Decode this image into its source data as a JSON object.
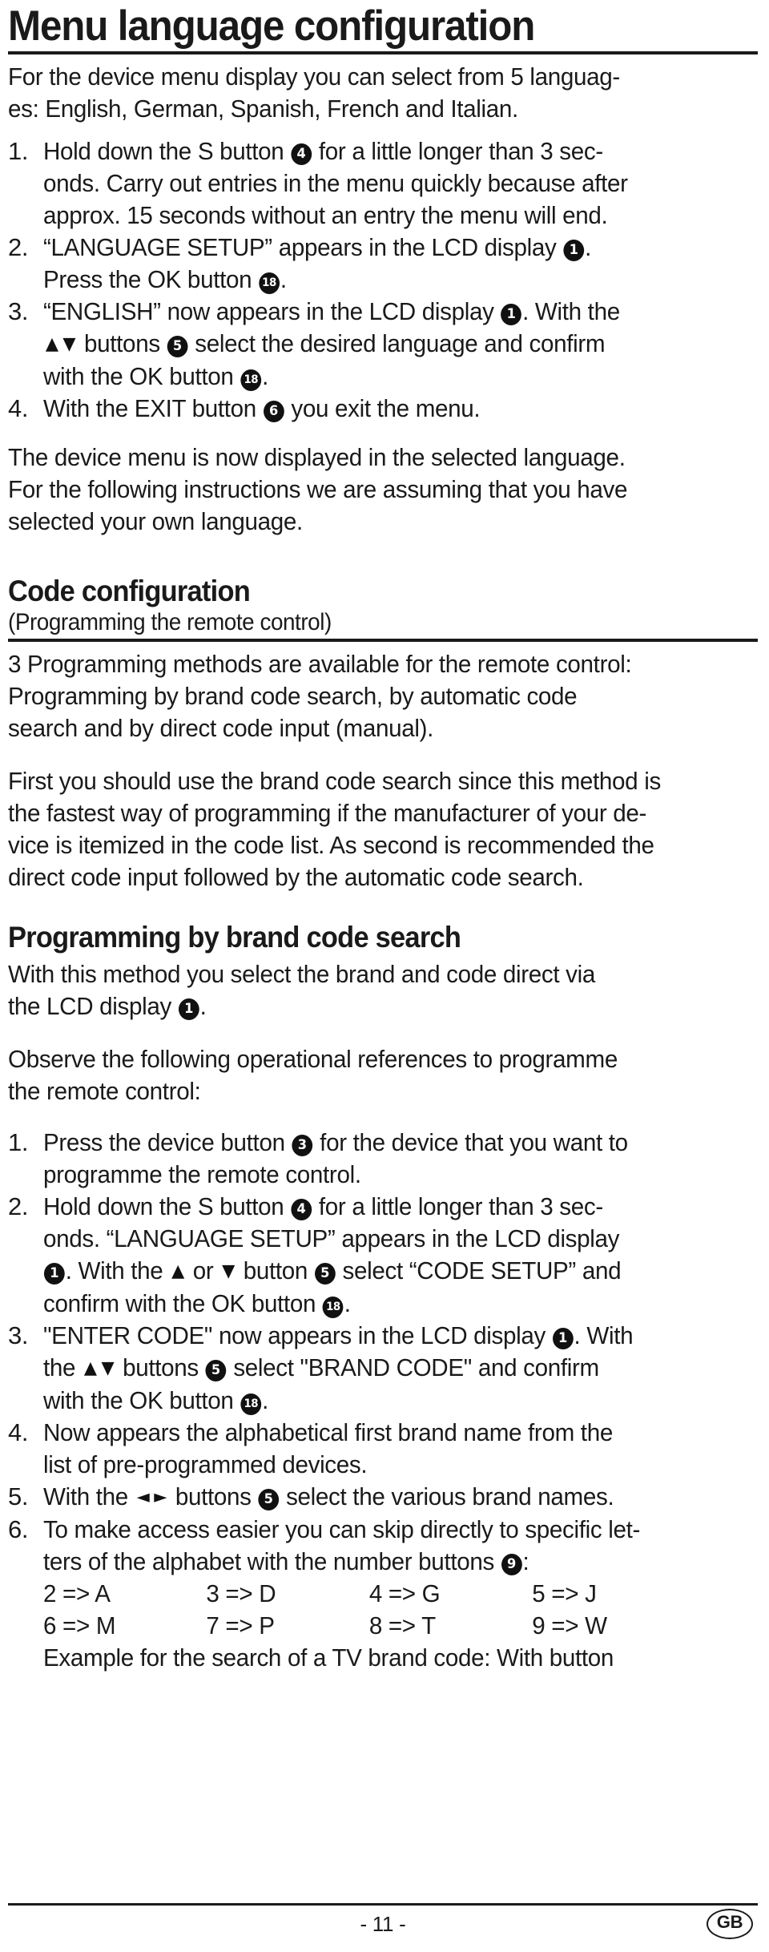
{
  "document": {
    "page_number": "- 11 -",
    "language_badge": "GB"
  },
  "section1": {
    "heading": "Menu language configuration",
    "intro": [
      "For the device menu display you can select from 5 languag-",
      "es: English, German, Spanish, French and Italian."
    ],
    "steps": [
      {
        "num": "1.",
        "lines": [
          "Hold down the S button [4] for a little longer than 3 sec-",
          "onds. Carry out entries in the menu quickly because after",
          "approx. 15 seconds without an entry the menu will end."
        ]
      },
      {
        "num": "2.",
        "lines": [
          "“LANGUAGE SETUP” appears in the LCD display [1].",
          "Press the OK button [18]."
        ]
      },
      {
        "num": "3.",
        "lines": [
          "“ENGLISH” now appears in the LCD display [1]. With the",
          "[up] [down] buttons [5] select the desired language and confirm",
          "with the OK button [18]."
        ]
      },
      {
        "num": "4.",
        "lines": [
          "With the EXIT button [6] you exit the menu."
        ]
      }
    ],
    "outro": [
      "The device menu is now displayed in the selected language.",
      "For the following instructions we are assuming that you have",
      "selected your own language."
    ]
  },
  "section2": {
    "heading": "Code configuration",
    "subheading": "(Programming the remote control)",
    "para1": [
      "3 Programming methods are available for the remote control:",
      "Programming by brand code search, by automatic code",
      "search and by direct code input (manual)."
    ],
    "para2": [
      "First you should use the brand code search since this method is",
      "the fastest way of programming if the manufacturer of your de-",
      "vice is itemized in the code list. As second is recommended the",
      "direct code input followed by the automatic code search."
    ]
  },
  "section3": {
    "heading": "Programming by brand code search",
    "para1": [
      "With this method you select the brand and code direct via",
      "the LCD display [1]."
    ],
    "para2": [
      "Observe the following operational references to programme",
      "the remote control:"
    ],
    "steps": [
      {
        "num": "1.",
        "lines": [
          "Press the device button [3] for the device that you want to",
          "programme the remote control."
        ]
      },
      {
        "num": "2.",
        "lines": [
          "Hold down the S button [4] for a little longer than 3 sec-",
          "onds. “LANGUAGE SETUP” appears in the LCD display",
          "[1]. With the [up] or [down] button [5] select \"CODE SETUP\" and",
          "confirm with the OK button [18]."
        ]
      },
      {
        "num": "3.",
        "lines": [
          "\"ENTER CODE\" now appears in the LCD display [1]. With",
          "the [up] [down] buttons [5] select \"BRAND CODE\" and confirm",
          "with the OK button [18]."
        ]
      },
      {
        "num": "4.",
        "lines": [
          "Now appears the alphabetical first brand name from the",
          "list of pre-programmed devices."
        ]
      },
      {
        "num": "5.",
        "lines": [
          "With the [left] [right] buttons [5] select the various brand names."
        ]
      },
      {
        "num": "6.",
        "lines": [
          "To make access easier you can skip directly to specific let-",
          "ters of the alphabet with the number buttons [9]:"
        ]
      }
    ],
    "code_table": {
      "rows": [
        [
          "2 => A",
          "3 => D",
          "4 => G",
          "5 => J"
        ],
        [
          "6 => M",
          "7 => P",
          "8 => T",
          "9 => W"
        ]
      ]
    },
    "example_line": "Example for the search of a TV brand code: With button"
  },
  "badges": {
    "lcd_display": "1",
    "device_button": "3",
    "s_button": "4",
    "arrow_buttons": "5",
    "exit_button": "6",
    "number_buttons": "9",
    "ok_button": "18"
  },
  "glyphs": {
    "arrow_up": "▲",
    "arrow_down": "▼",
    "arrow_left": "◄",
    "arrow_right": "►"
  }
}
